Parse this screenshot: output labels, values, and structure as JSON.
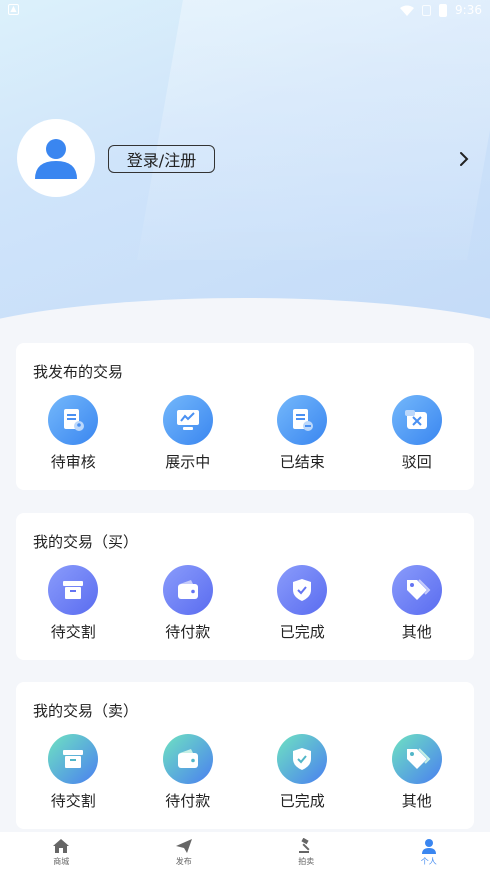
{
  "status_bar": {
    "time": "9:36"
  },
  "profile": {
    "login_label": "登录/注册"
  },
  "sections": [
    {
      "title": "我发布的交易",
      "items": [
        {
          "label": "待审核",
          "icon": "document-review-icon"
        },
        {
          "label": "展示中",
          "icon": "monitor-chart-icon"
        },
        {
          "label": "已结束",
          "icon": "document-minus-icon"
        },
        {
          "label": "驳回",
          "icon": "reject-box-icon"
        }
      ]
    },
    {
      "title": "我的交易（买）",
      "items": [
        {
          "label": "待交割",
          "icon": "archive-box-icon"
        },
        {
          "label": "待付款",
          "icon": "wallet-icon"
        },
        {
          "label": "已完成",
          "icon": "shield-check-icon"
        },
        {
          "label": "其他",
          "icon": "tag-icon"
        }
      ]
    },
    {
      "title": "我的交易（卖）",
      "items": [
        {
          "label": "待交割",
          "icon": "archive-box-icon"
        },
        {
          "label": "待付款",
          "icon": "wallet-icon"
        },
        {
          "label": "已完成",
          "icon": "shield-check-icon"
        },
        {
          "label": "其他",
          "icon": "tag-icon"
        }
      ]
    }
  ],
  "tabbar": {
    "items": [
      {
        "label": "商城",
        "icon": "home-icon"
      },
      {
        "label": "发布",
        "icon": "send-icon"
      },
      {
        "label": "拍卖",
        "icon": "gavel-icon"
      },
      {
        "label": "个人",
        "icon": "person-icon"
      }
    ],
    "active": "个人"
  },
  "colors": {
    "accent": "#3a86f0",
    "icon_blue": "#4a90f2",
    "icon_purple": "#6474f3",
    "icon_teal": "#52c6c8"
  }
}
